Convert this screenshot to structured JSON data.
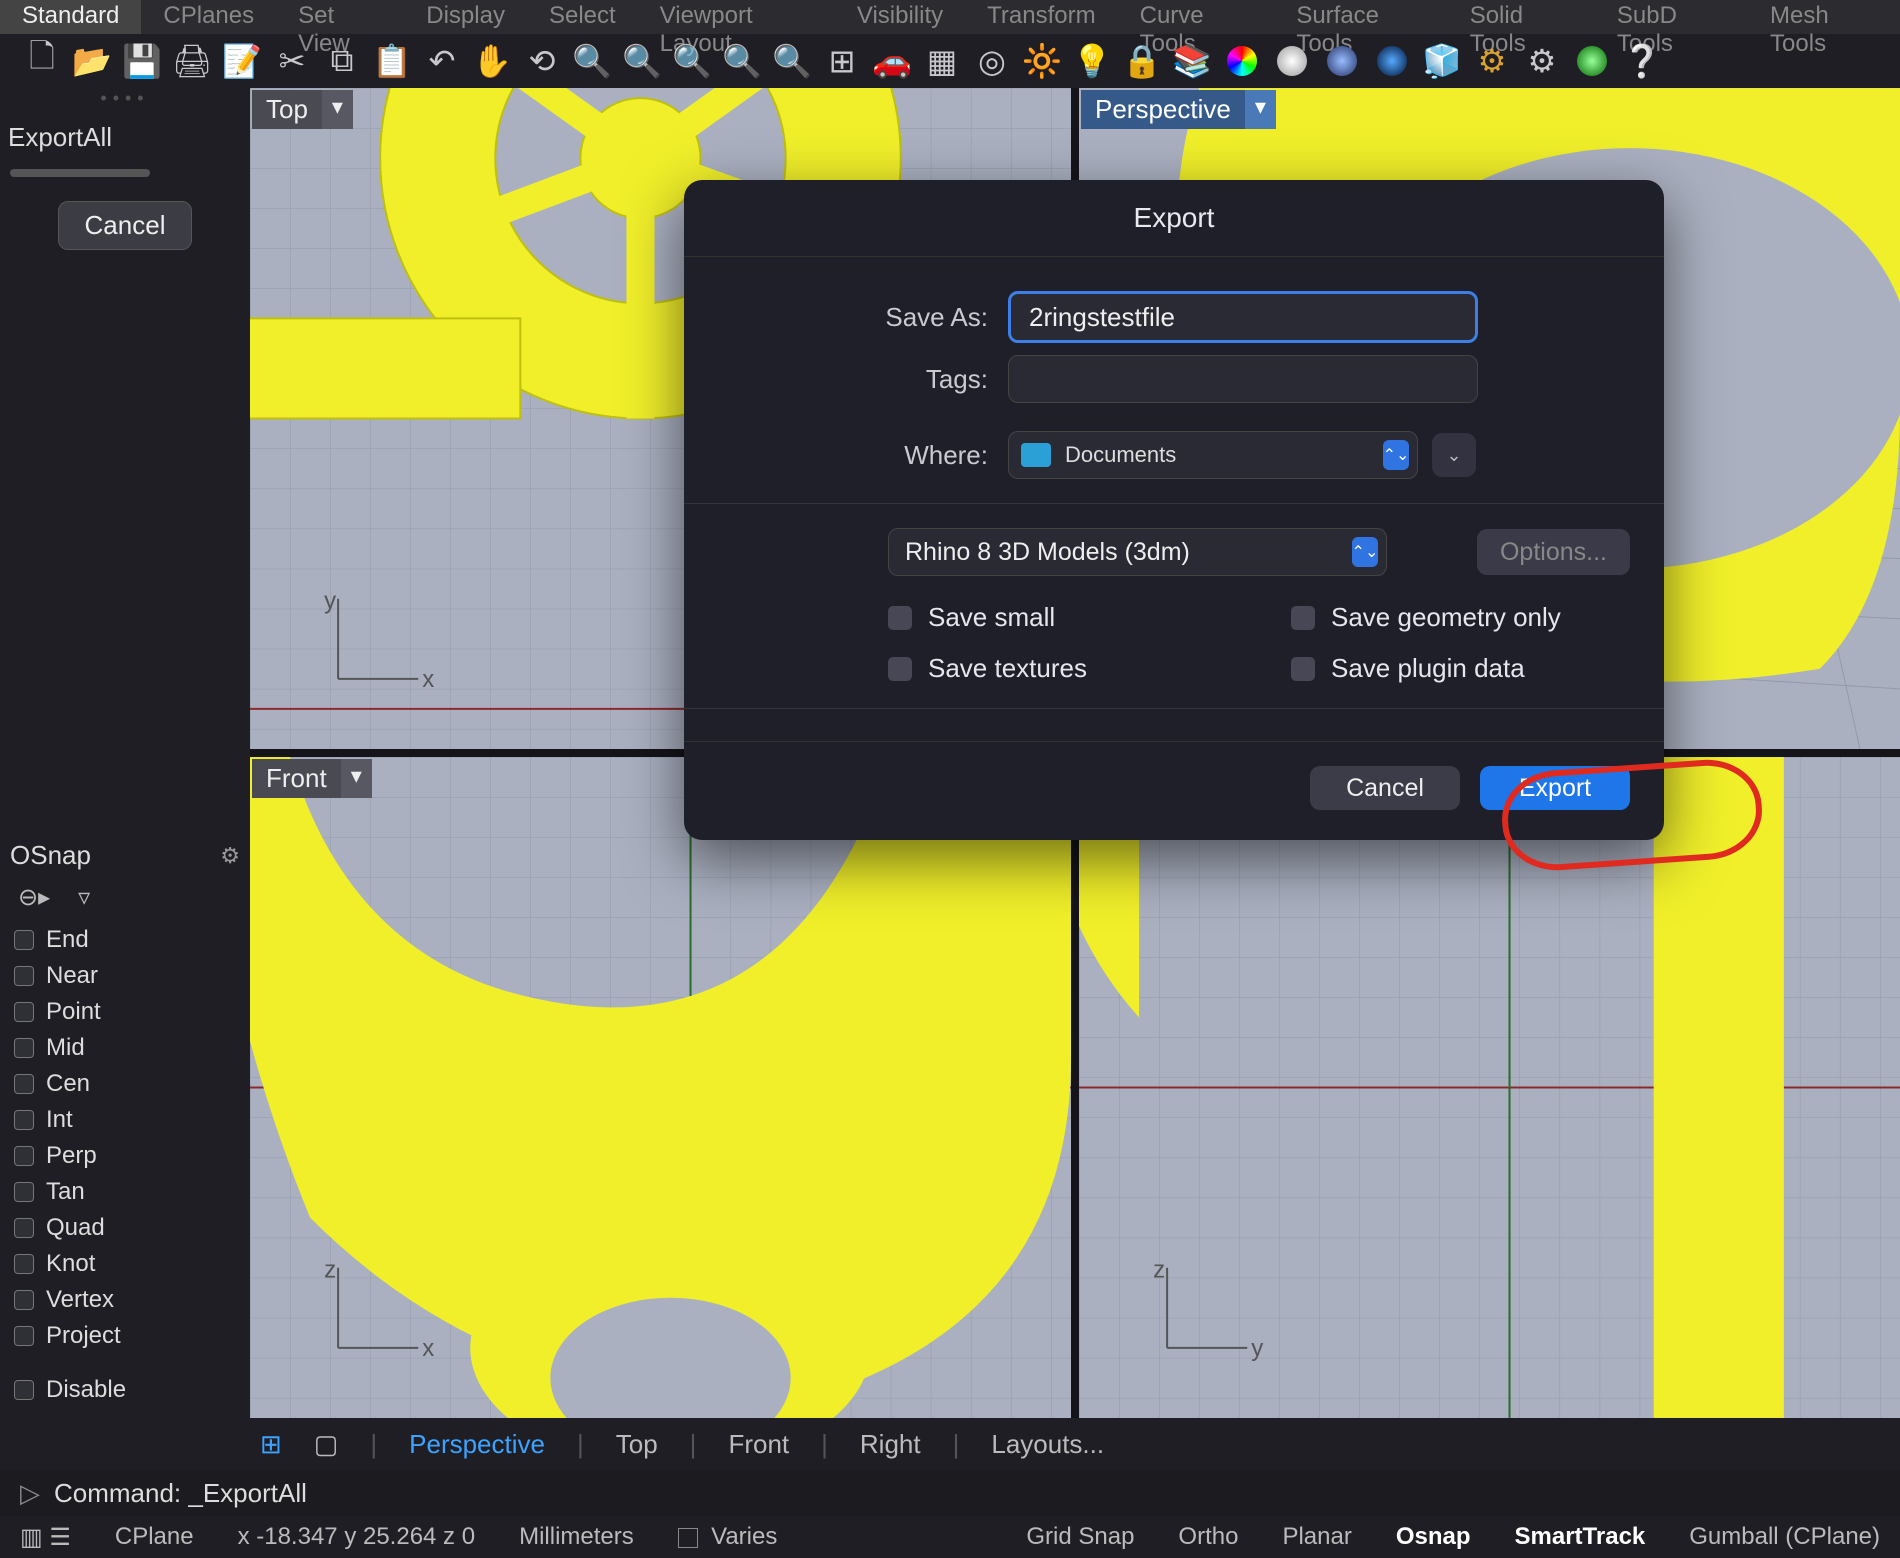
{
  "tabs": {
    "t0": "Standard",
    "t1": "CPlanes",
    "t2": "Set View",
    "t3": "Display",
    "t4": "Select",
    "t5": "Viewport Layout",
    "t6": "Visibility",
    "t7": "Transform",
    "t8": "Curve Tools",
    "t9": "Surface Tools",
    "t10": "Solid Tools",
    "t11": "SubD Tools",
    "t12": "Mesh Tools"
  },
  "toolbar_icons": [
    "new-file",
    "open",
    "save",
    "print",
    "notes",
    "cut",
    "copy",
    "paste",
    "undo",
    "pan",
    "rotate-view",
    "zoom-in",
    "zoom-window",
    "zoom-sel",
    "zoom-ext",
    "zoom-all",
    "4view",
    "render",
    "render-preview",
    "shade",
    "wireframe",
    "sun",
    "lock",
    "layers",
    "materials",
    "grad-edit",
    "env",
    "render-set",
    "options",
    "plugin",
    "help"
  ],
  "left": {
    "command": "ExportAll",
    "cancel": "Cancel"
  },
  "osnap": {
    "title": "OSnap",
    "items": [
      "End",
      "Near",
      "Point",
      "Mid",
      "Cen",
      "Int",
      "Perp",
      "Tan",
      "Quad",
      "Knot",
      "Vertex",
      "Project",
      "Disable"
    ]
  },
  "viewports": {
    "top": "Top",
    "persp": "Perspective",
    "front": "Front"
  },
  "axes": {
    "x": "x",
    "y": "y",
    "z": "z"
  },
  "dialog": {
    "title": "Export",
    "saveas_label": "Save As:",
    "saveas_value": "2ringstestfile",
    "tags_label": "Tags:",
    "where_label": "Where:",
    "where_value": "Documents",
    "format": "Rhino 8 3D Models (3dm)",
    "options": "Options...",
    "checks": {
      "small": "Save small",
      "geom": "Save geometry only",
      "tex": "Save textures",
      "plug": "Save plugin data"
    },
    "cancel": "Cancel",
    "export": "Export"
  },
  "bottom_tabs": {
    "persp": "Perspective",
    "top": "Top",
    "front": "Front",
    "right": "Right",
    "layouts": "Layouts..."
  },
  "cmd": {
    "text": "Command: _ExportAll"
  },
  "status": {
    "cplane": "CPlane",
    "coords": "x -18.347  y 25.264  z 0",
    "units": "Millimeters",
    "varies": "Varies",
    "gridsnap": "Grid Snap",
    "ortho": "Ortho",
    "planar": "Planar",
    "osnap": "Osnap",
    "smart": "SmartTrack",
    "gumball": "Gumball (CPlane)"
  }
}
